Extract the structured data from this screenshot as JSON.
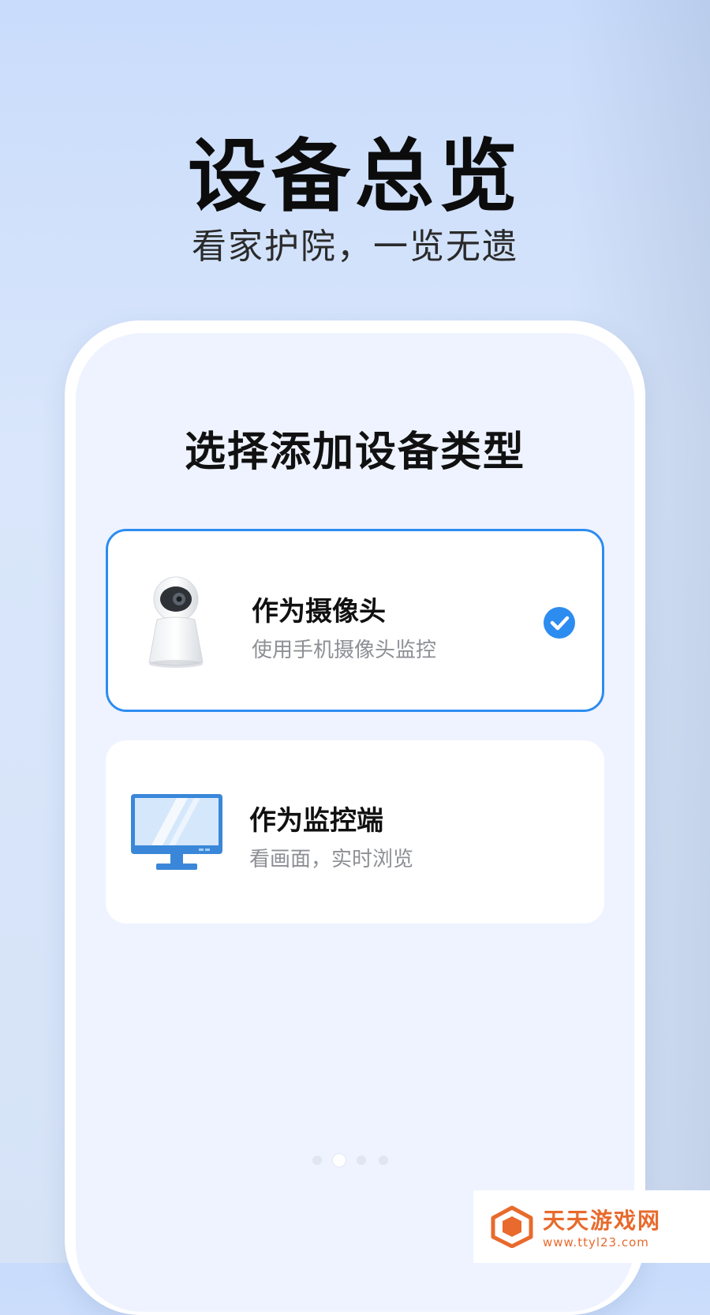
{
  "header": {
    "title": "设备总览",
    "subtitle": "看家护院，一览无遗"
  },
  "screen": {
    "title": "选择添加设备类型",
    "options": [
      {
        "title": "作为摄像头",
        "subtitle": "使用手机摄像头监控",
        "icon": "camera-icon",
        "selected": true
      },
      {
        "title": "作为监控端",
        "subtitle": "看画面，实时浏览",
        "icon": "monitor-icon",
        "selected": false
      }
    ],
    "page_indicator": {
      "total": 4,
      "current": 2
    }
  },
  "watermark": {
    "name": "天天游戏网",
    "url": "www.ttyl23.com"
  },
  "colors": {
    "accent": "#2d8cf0",
    "watermark": "#e86a2c"
  }
}
